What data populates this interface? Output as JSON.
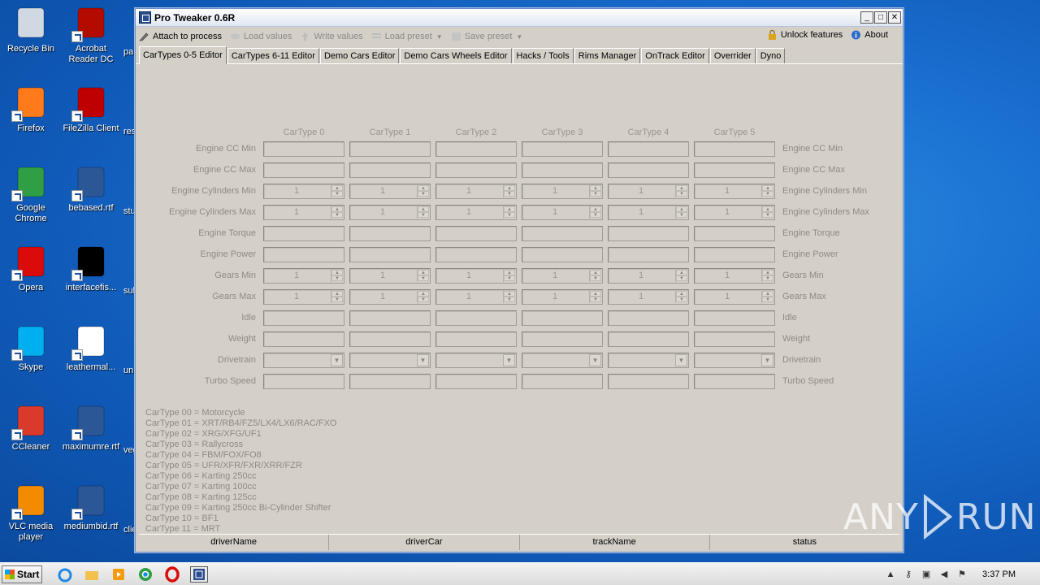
{
  "window": {
    "title": "Pro Tweaker 0.6R"
  },
  "toolbar": {
    "attach": "Attach to process",
    "load_values": "Load values",
    "write_values": "Write values",
    "load_preset": "Load preset",
    "save_preset": "Save preset",
    "unlock": "Unlock features",
    "about": "About"
  },
  "tabs": [
    "CarTypes 0-5 Editor",
    "CarTypes 6-11 Editor",
    "Demo Cars Editor",
    "Demo Cars Wheels Editor",
    "Hacks / Tools",
    "Rims Manager",
    "OnTrack Editor",
    "Overrider",
    "Dyno"
  ],
  "columns": [
    "CarType 0",
    "CarType 1",
    "CarType 2",
    "CarType 3",
    "CarType 4",
    "CarType 5"
  ],
  "rows": [
    {
      "label": "Engine CC Min",
      "kind": "text"
    },
    {
      "label": "Engine CC Max",
      "kind": "text"
    },
    {
      "label": "Engine Cylinders Min",
      "kind": "spin",
      "value": "1"
    },
    {
      "label": "Engine Cylinders Max",
      "kind": "spin",
      "value": "1"
    },
    {
      "label": "Engine Torque",
      "kind": "text"
    },
    {
      "label": "Engine Power",
      "kind": "text"
    },
    {
      "label": "Gears Min",
      "kind": "spin",
      "value": "1"
    },
    {
      "label": "Gears Max",
      "kind": "spin",
      "value": "1"
    },
    {
      "label": "Idle",
      "kind": "text"
    },
    {
      "label": "Weight",
      "kind": "text"
    },
    {
      "label": "Drivetrain",
      "kind": "combo"
    },
    {
      "label": "Turbo Speed",
      "kind": "text"
    }
  ],
  "legend": [
    "CarType 00 = Motorcycle",
    "CarType 01 = XRT/RB4/FZ5/LX4/LX6/RAC/FXO",
    "CarType 02 = XRG/XFG/UF1",
    "CarType 03 = Rallycross",
    "CarType 04 = FBM/FOX/FO8",
    "CarType 05 = UFR/XFR/FXR/XRR/FZR",
    "CarType 06 = Karting 250cc",
    "CarType 07 = Karting 100cc",
    "CarType 08 = Karting 125cc",
    "CarType 09 = Karting 250cc Bi-Cylinder Shifter",
    "CarType 10 = BF1",
    "CarType 11 = MRT"
  ],
  "grid_headers": [
    "driverName",
    "driverCar",
    "trackName",
    "status"
  ],
  "desktop": {
    "icons": [
      {
        "label": "Recycle Bin",
        "icon": "recycle-bin-icon",
        "color": "#cfd8e3"
      },
      {
        "label": "Acrobat Reader DC",
        "icon": "acrobat-icon",
        "color": "#b30b00"
      },
      {
        "label": "Firefox",
        "icon": "firefox-icon",
        "color": "#ff7a1a"
      },
      {
        "label": "FileZilla Client",
        "icon": "filezilla-icon",
        "color": "#bf0000"
      },
      {
        "label": "Google Chrome",
        "icon": "chrome-icon",
        "color": "#2f9e44"
      },
      {
        "label": "bebased.rtf",
        "icon": "word-doc-icon",
        "color": "#2b5797"
      },
      {
        "label": "Opera",
        "icon": "opera-icon",
        "color": "#d90b0b"
      },
      {
        "label": "interfacefis...",
        "icon": "black-file-icon",
        "color": "#000000"
      },
      {
        "label": "Skype",
        "icon": "skype-icon",
        "color": "#00aff0"
      },
      {
        "label": "leathermal...",
        "icon": "blank-file-icon",
        "color": "#ffffff"
      },
      {
        "label": "CCleaner",
        "icon": "ccleaner-icon",
        "color": "#d93a2b"
      },
      {
        "label": "maximumre.rtf",
        "icon": "word-doc-icon",
        "color": "#2b5797"
      },
      {
        "label": "VLC media player",
        "icon": "vlc-icon",
        "color": "#f28b00"
      },
      {
        "label": "mediumbid.rtf",
        "icon": "word-doc-icon",
        "color": "#2b5797"
      }
    ],
    "partials": [
      "pa",
      "res",
      "stu",
      "sul",
      "uni",
      "veg",
      "clie"
    ]
  },
  "taskbar": {
    "start": "Start",
    "time": "3:37 PM"
  },
  "watermark": {
    "left": "ANY",
    "right": "RUN"
  }
}
